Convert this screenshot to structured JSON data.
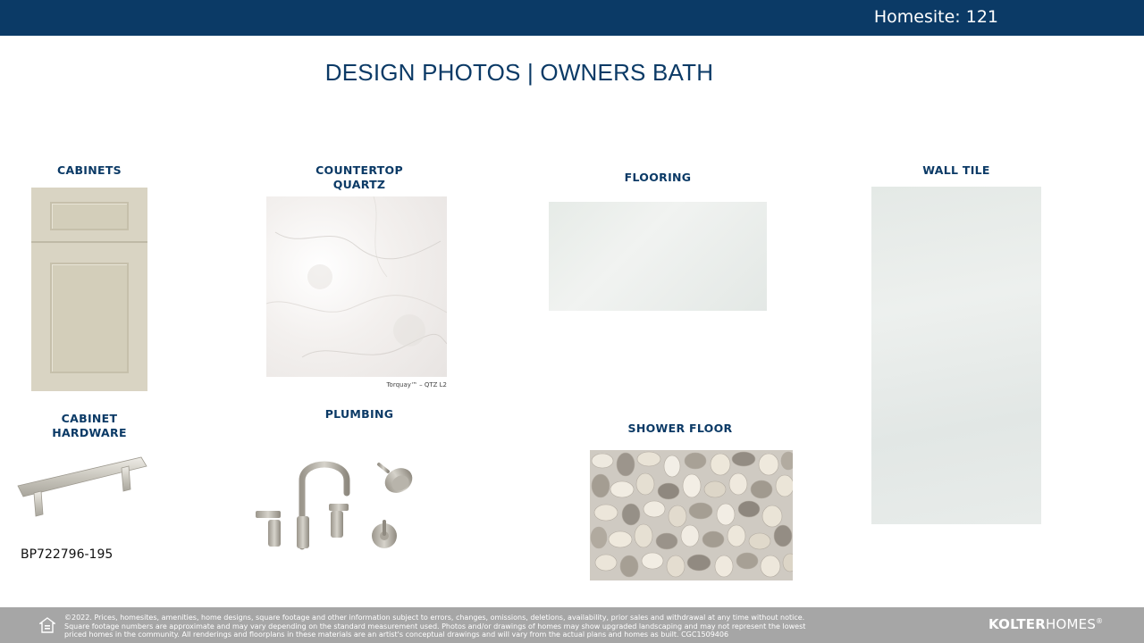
{
  "header": {
    "homesite": "Homesite: 121",
    "bar_color": "#0b3a66"
  },
  "title": "DESIGN PHOTOS | OWNERS BATH",
  "sections": {
    "cabinets": {
      "label": "CABINETS"
    },
    "countertop": {
      "label_line1": "COUNTERTOP",
      "label_line2": "QUARTZ",
      "note": "Torquay™ – QTZ L2"
    },
    "flooring": {
      "label": "FLOORING"
    },
    "wall_tile": {
      "label": "WALL TILE"
    },
    "cabinet_hardware": {
      "label_line1": "CABINET",
      "label_line2": "HARDWARE",
      "code": "BP722796-195"
    },
    "plumbing": {
      "label": "PLUMBING"
    },
    "shower_floor": {
      "label": "SHOWER FLOOR"
    }
  },
  "footer": {
    "line1": "©2022. Prices, homesites, amenities, home designs, square footage and other information subject to errors, changes, omissions, deletions, availability, prior sales and withdrawal at any time without notice.",
    "line2": "Square footage numbers are approximate and may vary depending on the standard measurement used. Photos and/or drawings of homes may show upgraded landscaping and may not represent the lowest",
    "line3": "priced homes in the community. All renderings and floorplans in these materials are an artist's conceptual drawings and will vary from the actual plans and homes as built. CGC1509406",
    "logo_bold": "KOLTER",
    "logo_light": "HOMES",
    "logo_mark": "®",
    "icon": "equal-housing-icon"
  }
}
